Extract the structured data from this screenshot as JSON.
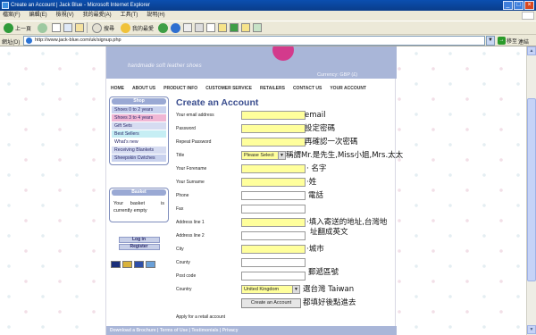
{
  "window": {
    "title": "Create an Account | Jack Blue - Microsoft Internet Explorer",
    "min": "_",
    "max": "□",
    "close": "×"
  },
  "menu": [
    "檔案(F)",
    "編輯(E)",
    "檢視(V)",
    "我的最愛(A)",
    "工具(T)",
    "說明(H)"
  ],
  "toolbar": {
    "back": "上一頁",
    "search": "搜尋",
    "favorites": "我的最愛"
  },
  "address": {
    "label": "網址(D)",
    "url": "http://www.jack-blue.com/uk/signup.php",
    "go": "移至",
    "links": "連結"
  },
  "site": {
    "tagline": "handmade soft leather shoes",
    "currency": "Currency: GBP (£)",
    "nav": [
      "HOME",
      "ABOUT US",
      "PRODUCT INFO",
      "CUSTOMER SERVICE",
      "RETAILERS",
      "CONTACT US",
      "YOUR ACCOUNT"
    ],
    "shop": {
      "title": "Shop",
      "items": [
        {
          "label": "Shoes 0 to 2 years",
          "bg": "#c9d2ee"
        },
        {
          "label": "Shoes 3 to 4 years",
          "bg": "#f0b6d4"
        },
        {
          "label": "Gift Sets",
          "bg": "#d6dcf1"
        },
        {
          "label": "Best Sellers",
          "bg": "#c6eef4"
        },
        {
          "label": "What's new",
          "bg": "#ffffff"
        },
        {
          "label": "Receiving Blankets",
          "bg": "#d6dcf1"
        },
        {
          "label": "Sheepskin Cwtches",
          "bg": "#c9d2ee"
        }
      ]
    },
    "basket": {
      "title": "Basket",
      "line1a": "Your",
      "line1b": "basket",
      "line1c": "is",
      "line2": "currently empty"
    },
    "login": "Log in",
    "register": "Register",
    "card_colors": [
      "#1a2f7a",
      "#d9b23a",
      "#2e4fa8",
      "#6aa0d8"
    ],
    "footer": "Download a Brochure  |  Terms of Use  |  Testimonials  |  Privacy"
  },
  "form": {
    "heading": "Create an Account",
    "fields": {
      "email": {
        "label": "Your email address",
        "note": "email"
      },
      "password": {
        "label": "Password",
        "note": "設定密碼"
      },
      "repeat": {
        "label": "Repeat Password",
        "note": "再確認一次密碼"
      },
      "title": {
        "label": "Title",
        "value": "Please Select",
        "note": "稱謂Mr.是先生,Miss小姐,Mrs.太太"
      },
      "forename": {
        "label": "Your Forename",
        "note": "名字"
      },
      "surname": {
        "label": "Your Surname",
        "note": "姓"
      },
      "phone": {
        "label": "Phone",
        "note": "電話"
      },
      "fax": {
        "label": "Fax"
      },
      "addr1": {
        "label": "Address line 1",
        "note": "填入寄送的地址,台灣地"
      },
      "addr2": {
        "label": "Address line 2",
        "note": "址翻成英文"
      },
      "city": {
        "label": "City",
        "note": "城市"
      },
      "county": {
        "label": "County"
      },
      "postcode": {
        "label": "Post code",
        "note": "郵遞區號"
      },
      "country": {
        "label": "Country",
        "value": "United Kingdom",
        "note": "選台灣 Taiwan"
      },
      "submit": {
        "label": "Create an Account",
        "note": "都填好後點進去"
      },
      "retail": {
        "label": "Apply for a retail account"
      }
    }
  }
}
